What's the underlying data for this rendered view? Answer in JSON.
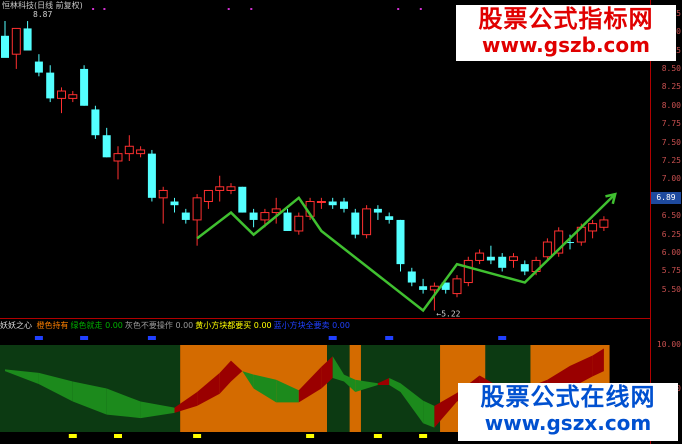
{
  "header": {
    "title": "恒林科技(日线 前复权)",
    "high_label": "8.87"
  },
  "price_axis": {
    "ticks": [
      "9.25",
      "9.00",
      "8.75",
      "8.50",
      "8.25",
      "8.00",
      "7.75",
      "7.50",
      "7.25",
      "7.00",
      "6.75",
      "6.50",
      "6.25",
      "6.00",
      "5.75",
      "5.50"
    ],
    "current_price": "6.89",
    "low_label": "5.22"
  },
  "indicator": {
    "name": "妖妖之心",
    "items": [
      {
        "label": "橙色持有",
        "value": "",
        "color": "#ff8000"
      },
      {
        "label": "绿色就走",
        "value": "0.00",
        "color": "#00b000"
      },
      {
        "label": "灰色不要操作",
        "value": "0.00",
        "color": "#9a9a9a"
      },
      {
        "label": "黄小方块都要买",
        "value": "0.00",
        "color": "#ffff00"
      },
      {
        "label": "蓝小方块全要卖",
        "value": "0.00",
        "color": "#2040ff"
      }
    ],
    "axis_ticks": [
      "10.00",
      "5.00"
    ]
  },
  "watermarks": {
    "top_line1": "股票公式指标网",
    "top_line2": "www.gszb.com",
    "bottom_line1": "股票公式在线网",
    "bottom_line2": "www.gszx.com"
  },
  "chart_data": {
    "type": "candlestick",
    "ylim": [
      5.2,
      9.3
    ],
    "candles": [
      {
        "o": 8.95,
        "h": 9.15,
        "l": 8.7,
        "c": 8.65,
        "up": false
      },
      {
        "o": 8.7,
        "h": 9.05,
        "l": 8.5,
        "c": 9.05,
        "up": true
      },
      {
        "o": 9.05,
        "h": 9.15,
        "l": 8.75,
        "c": 8.75,
        "up": false
      },
      {
        "o": 8.6,
        "h": 8.7,
        "l": 8.4,
        "c": 8.45,
        "up": false
      },
      {
        "o": 8.45,
        "h": 8.55,
        "l": 8.05,
        "c": 8.1,
        "up": false
      },
      {
        "o": 8.1,
        "h": 8.25,
        "l": 7.9,
        "c": 8.2,
        "up": true
      },
      {
        "o": 8.1,
        "h": 8.2,
        "l": 8.05,
        "c": 8.15,
        "up": true
      },
      {
        "o": 8.5,
        "h": 8.55,
        "l": 8.0,
        "c": 8.0,
        "up": false
      },
      {
        "o": 7.95,
        "h": 8.0,
        "l": 7.55,
        "c": 7.6,
        "up": false
      },
      {
        "o": 7.6,
        "h": 7.7,
        "l": 7.3,
        "c": 7.3,
        "up": false
      },
      {
        "o": 7.35,
        "h": 7.45,
        "l": 7.0,
        "c": 7.25,
        "up": true
      },
      {
        "o": 7.45,
        "h": 7.6,
        "l": 7.25,
        "c": 7.35,
        "up": true
      },
      {
        "o": 7.35,
        "h": 7.45,
        "l": 7.3,
        "c": 7.4,
        "up": true
      },
      {
        "o": 7.35,
        "h": 7.4,
        "l": 6.7,
        "c": 6.75,
        "up": false
      },
      {
        "o": 6.75,
        "h": 6.9,
        "l": 6.4,
        "c": 6.85,
        "up": true
      },
      {
        "o": 6.7,
        "h": 6.75,
        "l": 6.55,
        "c": 6.65,
        "up": false
      },
      {
        "o": 6.55,
        "h": 6.6,
        "l": 6.4,
        "c": 6.45,
        "up": false
      },
      {
        "o": 6.45,
        "h": 6.8,
        "l": 6.1,
        "c": 6.75,
        "up": true
      },
      {
        "o": 6.7,
        "h": 6.8,
        "l": 6.6,
        "c": 6.85,
        "up": true
      },
      {
        "o": 6.85,
        "h": 7.05,
        "l": 6.7,
        "c": 6.9,
        "up": true
      },
      {
        "o": 6.85,
        "h": 6.95,
        "l": 6.8,
        "c": 6.9,
        "up": true
      },
      {
        "o": 6.9,
        "h": 6.9,
        "l": 6.55,
        "c": 6.55,
        "up": false
      },
      {
        "o": 6.55,
        "h": 6.6,
        "l": 6.35,
        "c": 6.45,
        "up": false
      },
      {
        "o": 6.45,
        "h": 6.6,
        "l": 6.35,
        "c": 6.55,
        "up": true
      },
      {
        "o": 6.55,
        "h": 6.75,
        "l": 6.4,
        "c": 6.6,
        "up": true
      },
      {
        "o": 6.55,
        "h": 6.6,
        "l": 6.3,
        "c": 6.3,
        "up": false
      },
      {
        "o": 6.3,
        "h": 6.55,
        "l": 6.25,
        "c": 6.5,
        "up": true
      },
      {
        "o": 6.5,
        "h": 6.75,
        "l": 6.45,
        "c": 6.7,
        "up": true
      },
      {
        "o": 6.7,
        "h": 6.75,
        "l": 6.6,
        "c": 6.7,
        "up": true
      },
      {
        "o": 6.7,
        "h": 6.75,
        "l": 6.6,
        "c": 6.65,
        "up": false
      },
      {
        "o": 6.7,
        "h": 6.75,
        "l": 6.55,
        "c": 6.6,
        "up": false
      },
      {
        "o": 6.55,
        "h": 6.6,
        "l": 6.2,
        "c": 6.25,
        "up": false
      },
      {
        "o": 6.25,
        "h": 6.65,
        "l": 6.2,
        "c": 6.6,
        "up": true
      },
      {
        "o": 6.6,
        "h": 6.65,
        "l": 6.45,
        "c": 6.55,
        "up": false
      },
      {
        "o": 6.5,
        "h": 6.55,
        "l": 6.4,
        "c": 6.45,
        "up": false
      },
      {
        "o": 6.45,
        "h": 6.45,
        "l": 5.75,
        "c": 5.85,
        "up": false
      },
      {
        "o": 5.75,
        "h": 5.8,
        "l": 5.55,
        "c": 5.6,
        "up": false
      },
      {
        "o": 5.55,
        "h": 5.65,
        "l": 5.45,
        "c": 5.5,
        "up": false
      },
      {
        "o": 5.5,
        "h": 5.6,
        "l": 5.22,
        "c": 5.55,
        "up": true
      },
      {
        "o": 5.6,
        "h": 5.6,
        "l": 5.45,
        "c": 5.5,
        "up": false
      },
      {
        "o": 5.45,
        "h": 5.7,
        "l": 5.4,
        "c": 5.65,
        "up": true
      },
      {
        "o": 5.6,
        "h": 5.95,
        "l": 5.55,
        "c": 5.9,
        "up": true
      },
      {
        "o": 5.9,
        "h": 6.05,
        "l": 5.85,
        "c": 6.0,
        "up": true
      },
      {
        "o": 5.95,
        "h": 6.1,
        "l": 5.85,
        "c": 5.9,
        "up": false
      },
      {
        "o": 5.95,
        "h": 6.0,
        "l": 5.75,
        "c": 5.8,
        "up": false
      },
      {
        "o": 5.9,
        "h": 6.0,
        "l": 5.8,
        "c": 5.95,
        "up": true
      },
      {
        "o": 5.85,
        "h": 5.9,
        "l": 5.7,
        "c": 5.75,
        "up": false
      },
      {
        "o": 5.75,
        "h": 5.95,
        "l": 5.7,
        "c": 5.9,
        "up": true
      },
      {
        "o": 5.95,
        "h": 6.2,
        "l": 5.9,
        "c": 6.15,
        "up": true
      },
      {
        "o": 6.0,
        "h": 6.35,
        "l": 5.95,
        "c": 6.3,
        "up": true
      },
      {
        "o": 6.15,
        "h": 6.25,
        "l": 6.05,
        "c": 6.15,
        "up": false
      },
      {
        "o": 6.15,
        "h": 6.4,
        "l": 6.1,
        "c": 6.35,
        "up": true
      },
      {
        "o": 6.3,
        "h": 6.45,
        "l": 6.2,
        "c": 6.4,
        "up": true
      },
      {
        "o": 6.35,
        "h": 6.5,
        "l": 6.3,
        "c": 6.45,
        "up": true
      }
    ],
    "trend_line": [
      [
        17,
        6.2
      ],
      [
        20,
        6.55
      ],
      [
        22,
        6.25
      ],
      [
        26,
        6.75
      ],
      [
        28,
        6.3
      ],
      [
        37,
        5.22
      ],
      [
        40,
        5.85
      ],
      [
        46,
        5.6
      ],
      [
        54,
        6.8
      ]
    ],
    "indicator_zones": [
      {
        "from": 0,
        "to": 15,
        "color": "green"
      },
      {
        "from": 16,
        "to": 28,
        "color": "orange"
      },
      {
        "from": 29,
        "to": 31,
        "color": "green"
      },
      {
        "from": 31,
        "to": 32,
        "color": "orange"
      },
      {
        "from": 32,
        "to": 39,
        "color": "green"
      },
      {
        "from": 39,
        "to": 43,
        "color": "orange"
      },
      {
        "from": 43,
        "to": 47,
        "color": "green"
      },
      {
        "from": 47,
        "to": 53,
        "color": "orange"
      }
    ],
    "indicator_band": [
      {
        "i": 0,
        "top": 7.2,
        "bot": 7.0,
        "color": "green"
      },
      {
        "i": 3,
        "top": 6.8,
        "bot": 5.5,
        "color": "green"
      },
      {
        "i": 6,
        "top": 5.8,
        "bot": 3.5,
        "color": "green"
      },
      {
        "i": 9,
        "top": 5.0,
        "bot": 2.0,
        "color": "green"
      },
      {
        "i": 12,
        "top": 3.5,
        "bot": 1.6,
        "color": "green"
      },
      {
        "i": 15,
        "top": 2.8,
        "bot": 2.2,
        "color": "green"
      },
      {
        "i": 17,
        "top": 4.6,
        "bot": 3.0,
        "color": "red"
      },
      {
        "i": 19,
        "top": 6.8,
        "bot": 4.4,
        "color": "red"
      },
      {
        "i": 20,
        "top": 8.2,
        "bot": 5.8,
        "color": "red"
      },
      {
        "i": 21,
        "top": 7.0,
        "bot": 7.0,
        "color": "red"
      },
      {
        "i": 22,
        "top": 6.6,
        "bot": 5.0,
        "color": "green"
      },
      {
        "i": 24,
        "top": 6.0,
        "bot": 3.4,
        "color": "green"
      },
      {
        "i": 26,
        "top": 4.8,
        "bot": 3.4,
        "color": "green"
      },
      {
        "i": 28,
        "top": 7.5,
        "bot": 5.0,
        "color": "red"
      },
      {
        "i": 29,
        "top": 8.7,
        "bot": 6.2,
        "color": "red"
      },
      {
        "i": 30,
        "top": 6.6,
        "bot": 5.8,
        "color": "green"
      },
      {
        "i": 31,
        "top": 6.0,
        "bot": 4.6,
        "color": "green"
      },
      {
        "i": 33,
        "top": 5.6,
        "bot": 5.4,
        "color": "green"
      },
      {
        "i": 34,
        "top": 6.2,
        "bot": 5.4,
        "color": "red"
      },
      {
        "i": 35,
        "top": 5.6,
        "bot": 4.6,
        "color": "green"
      },
      {
        "i": 37,
        "top": 3.6,
        "bot": 1.0,
        "color": "green"
      },
      {
        "i": 38,
        "top": 3.0,
        "bot": 0.5,
        "color": "green"
      },
      {
        "i": 40,
        "top": 4.5,
        "bot": 3.5,
        "color": "red"
      },
      {
        "i": 42,
        "top": 6.5,
        "bot": 4.5,
        "color": "red"
      },
      {
        "i": 44,
        "top": 5.0,
        "bot": 4.6,
        "color": "red"
      },
      {
        "i": 46,
        "top": 5.0,
        "bot": 3.8,
        "color": "green"
      },
      {
        "i": 48,
        "top": 6.0,
        "bot": 4.0,
        "color": "red"
      },
      {
        "i": 50,
        "top": 7.6,
        "bot": 5.0,
        "color": "red"
      },
      {
        "i": 52,
        "top": 8.8,
        "bot": 6.4,
        "color": "red"
      },
      {
        "i": 53,
        "top": 9.6,
        "bot": 7.0,
        "color": "red"
      }
    ],
    "sell_markers": [
      3,
      7,
      13,
      29,
      34,
      44
    ],
    "buy_markers": [
      6,
      10,
      17,
      27,
      33,
      37
    ],
    "top_markers": [
      7,
      8,
      19,
      21,
      34,
      36,
      43
    ]
  },
  "colors": {
    "up": "#ff3030",
    "down": "#54ffff",
    "trend": "#40c030",
    "orange": "#d46b00",
    "green_zone": "#0c3a12",
    "red_band": "#9a0000",
    "green_band": "#1c8a1c",
    "axis": "#b00000"
  }
}
